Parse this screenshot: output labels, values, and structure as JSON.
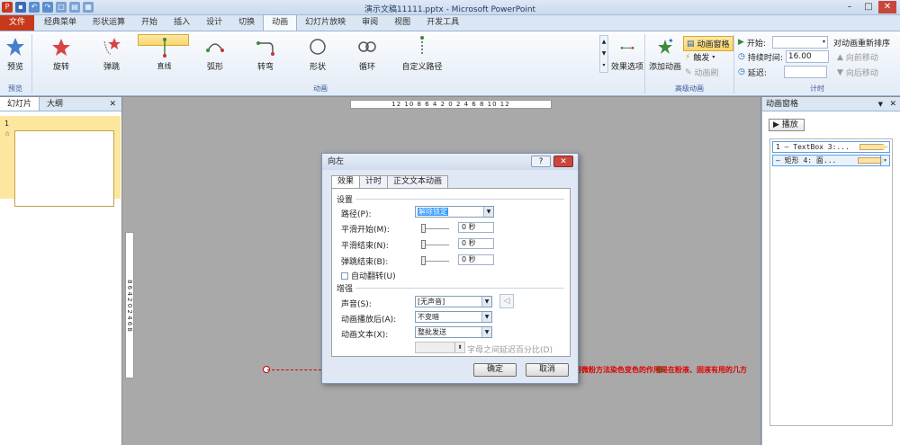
{
  "window": {
    "title": "演示文稿11111.pptx - Microsoft PowerPoint"
  },
  "tabs": [
    "经典菜单",
    "形状运算",
    "开始",
    "插入",
    "设计",
    "切换",
    "动画",
    "幻灯片放映",
    "审阅",
    "视图",
    "开发工具"
  ],
  "file_tab": "文件",
  "active_tab": "动画",
  "ribbon": {
    "preview": {
      "label": "预览",
      "group": "预览"
    },
    "animations": [
      "旋转",
      "弹跳",
      "直线",
      "弧形",
      "转弯",
      "形状",
      "循环",
      "自定义路径"
    ],
    "animation_group": "动画",
    "effect_options": "效果选项",
    "add_animation": "添加动画",
    "anim_pane_btn": "动画窗格",
    "trigger": "触发",
    "anim_painter": "动画刷",
    "advanced_group": "高级动画",
    "start_label": "开始:",
    "duration_label": "持续时间:",
    "duration_value": "16.00",
    "delay_label": "延迟:",
    "timing_group": "计时",
    "reorder_title": "对动画重新排序",
    "move_earlier": "向前移动",
    "move_later": "向后移动"
  },
  "left_panel": {
    "tab_slides": "幻灯片",
    "tab_outline": "大纲",
    "slide_number": "1"
  },
  "ruler": {
    "h": "12 10 8 6 4 2 0 2 4 6 8 10 12",
    "v": "8 6 4 2 0 2 4 6 8"
  },
  "slide": {
    "text": "用微粉方法染色变色的作用是在粉液、固液有用的几方"
  },
  "anim_pane": {
    "title": "动画窗格",
    "play": "播放",
    "items": [
      "1 — TextBox 3:...",
      "— 矩形 4: 面..."
    ]
  },
  "dialog": {
    "title": "向左",
    "tabs": [
      "效果",
      "计时",
      "正文文本动画"
    ],
    "section_settings": "设置",
    "path_label": "路径(P):",
    "path_value": "解除锁定",
    "smooth_start": "平滑开始(M):",
    "smooth_end": "平滑结束(N):",
    "bounce_end": "弹跳结束(B):",
    "zero": "0",
    "unit": "秒",
    "auto_reverse": "自动翻转(U)",
    "section_enhance": "增强",
    "sound_label": "声音(S):",
    "sound_value": "[无声音]",
    "after_label": "动画播放后(A):",
    "after_value": "不变暗",
    "text_label": "动画文本(X):",
    "text_value": "整批发送",
    "letter_delay": "字母之间延迟百分比(D)",
    "ok": "确定",
    "cancel": "取消"
  }
}
